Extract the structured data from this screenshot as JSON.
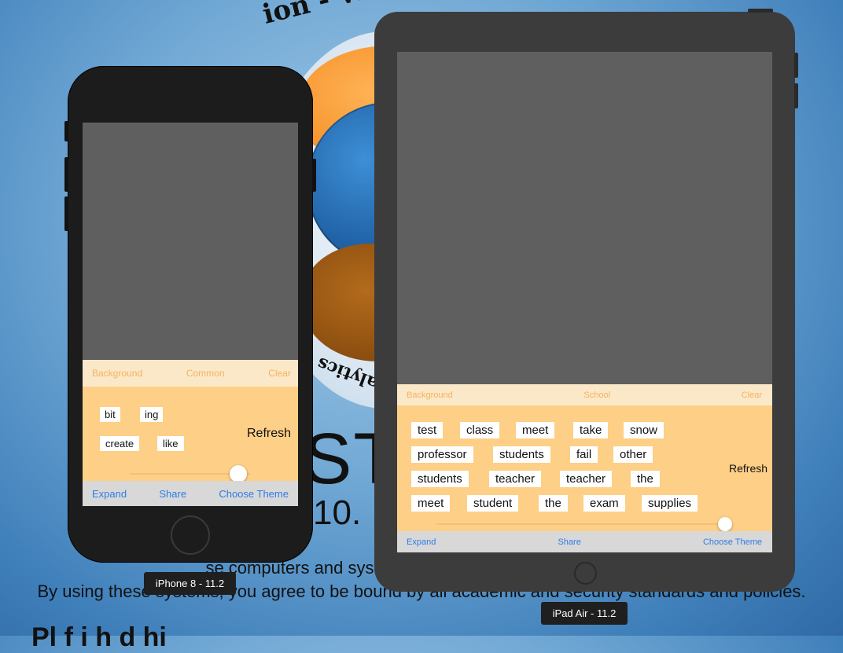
{
  "background": {
    "arc_text": "ion - Web - Database",
    "arc_text_bottom": "alytics",
    "big_letters": "ST",
    "version": "10.",
    "line1": "se computers and systems are governed by the                                                                   andards",
    "line2": "By using these systems, you agree to be bound by all academic and security standards and policies.",
    "line3": "Pl                                                        f    i  h d         hi"
  },
  "iphone": {
    "label": "iPhone 8 - 11.2",
    "top_toolbar": {
      "left": "Background",
      "center": "Common",
      "right": "Clear"
    },
    "words": [
      "bit",
      "ing",
      "create",
      "like"
    ],
    "refresh": "Refresh",
    "slider_value": 0.9,
    "bottom_toolbar": {
      "left": "Expand",
      "center": "Share",
      "right": "Choose Theme"
    }
  },
  "ipad": {
    "label": "iPad Air - 11.2",
    "top_toolbar": {
      "left": "Background",
      "center": "School",
      "right": "Clear"
    },
    "words": [
      [
        "test",
        "class",
        "meet",
        "take",
        "snow"
      ],
      [
        "professor",
        "students",
        "fail",
        "other"
      ],
      [
        "students",
        "teacher",
        "teacher",
        "the"
      ],
      [
        "meet",
        "student",
        "the",
        "exam",
        "supplies"
      ]
    ],
    "refresh": "Refresh",
    "slider_value": 0.98,
    "bottom_toolbar": {
      "left": "Expand",
      "center": "Share",
      "right": "Choose Theme"
    }
  },
  "colors": {
    "toolbar_top_bg": "#fbe8c8",
    "toolbar_top_text": "#f5b35c",
    "word_area_bg": "#fecf86",
    "toolbar_bottom_bg": "#d8d8d8",
    "link_blue": "#2f7be8"
  }
}
